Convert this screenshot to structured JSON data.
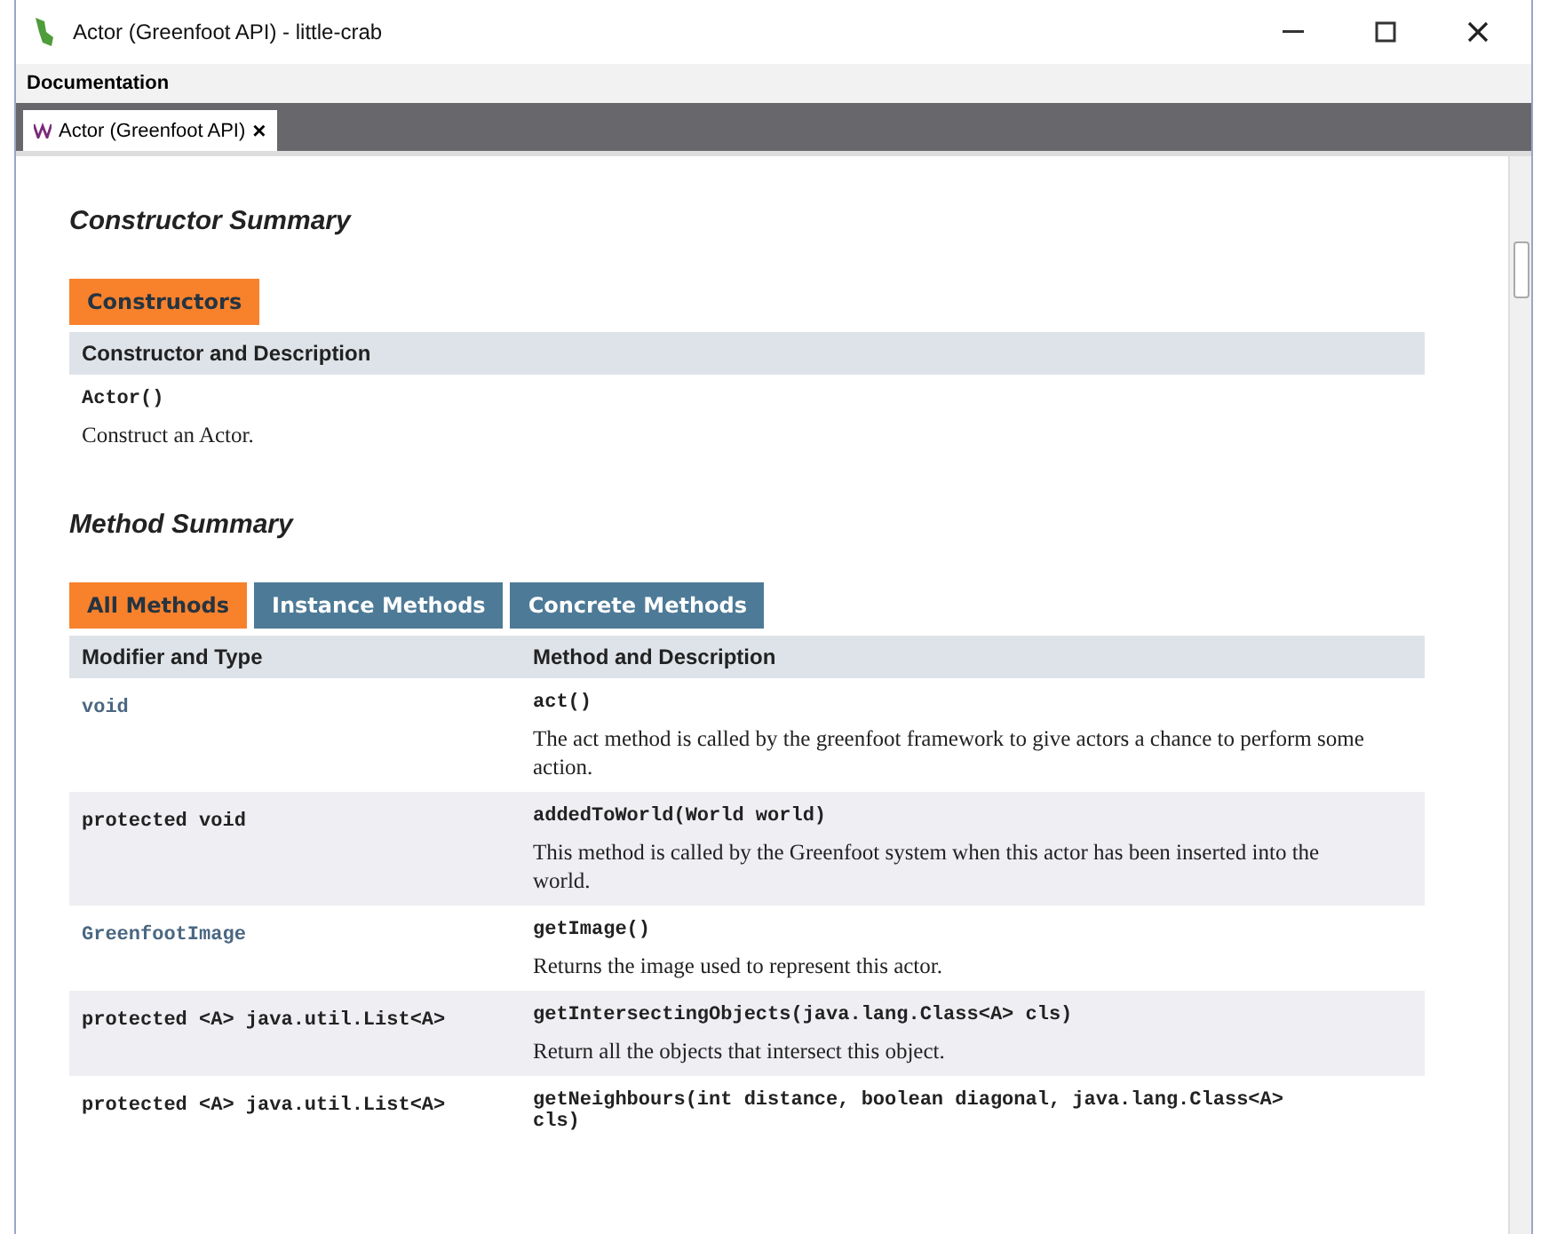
{
  "window": {
    "title": "Actor (Greenfoot API) - little-crab"
  },
  "menu": [
    "Documentation"
  ],
  "tabs": [
    {
      "label": "Actor (Greenfoot API)",
      "selected": true,
      "close": "×"
    }
  ],
  "constructor_summary": {
    "heading": "Constructor Summary",
    "tabs": [
      {
        "label": "Constructors",
        "selected": true
      }
    ],
    "columns": [
      "Constructor and Description"
    ],
    "rows": [
      {
        "signature": "Actor()",
        "description": "Construct an Actor."
      }
    ]
  },
  "method_summary": {
    "heading": "Method Summary",
    "tabs": [
      {
        "label": "All Methods",
        "selected": true
      },
      {
        "label": "Instance Methods",
        "selected": false
      },
      {
        "label": "Concrete Methods",
        "selected": false
      }
    ],
    "columns": [
      "Modifier and Type",
      "Method and Description"
    ],
    "rows": [
      {
        "modifier": "void",
        "linked": true,
        "signature": "act()",
        "description": "The act method is called by the greenfoot framework to give actors a chance to perform some action."
      },
      {
        "modifier": "protected void",
        "linked": false,
        "signature": "addedToWorld(World world)",
        "description": "This method is called by the Greenfoot system when this actor has been inserted into the world."
      },
      {
        "modifier": "GreenfootImage",
        "linked": true,
        "signature": "getImage()",
        "description": "Returns the image used to represent this actor."
      },
      {
        "modifier": "protected <A> java.util.List<A>",
        "linked": false,
        "signature": "getIntersectingObjects(java.lang.Class<A> cls)",
        "description": "Return all the objects that intersect this object."
      },
      {
        "modifier": "protected <A> java.util.List<A>",
        "linked": false,
        "signature": "getNeighbours(int distance, boolean diagonal, java.lang.Class<A> cls)"
      }
    ]
  }
}
